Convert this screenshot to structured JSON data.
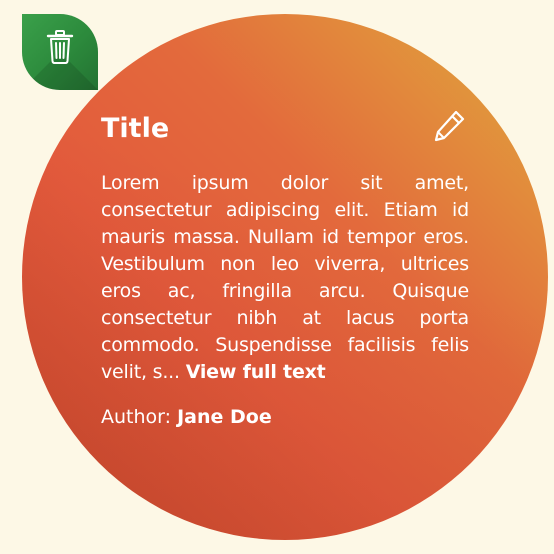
{
  "card": {
    "title": "Title",
    "body": "Lorem ipsum dolor sit amet, consectetur adipiscing elit. Etiam id mauris massa. Nullam id tempor eros. Vestibulum non leo viverra, ultrices eros ac, fringilla arcu. Quisque consectetur nibh at lacus porta commodo. Suspendisse facilisis felis velit, s...",
    "view_full_label": "View full text",
    "author_label": "Author:",
    "author_name": "Jane Doe"
  },
  "icons": {
    "delete": "trash-icon",
    "edit": "pencil-icon"
  },
  "colors": {
    "background": "#fdf8e6",
    "card_gradient_start": "#e0ad3c",
    "card_gradient_end": "#c9482e",
    "delete_leaf": "#2c8a3c",
    "text": "#ffffff"
  }
}
